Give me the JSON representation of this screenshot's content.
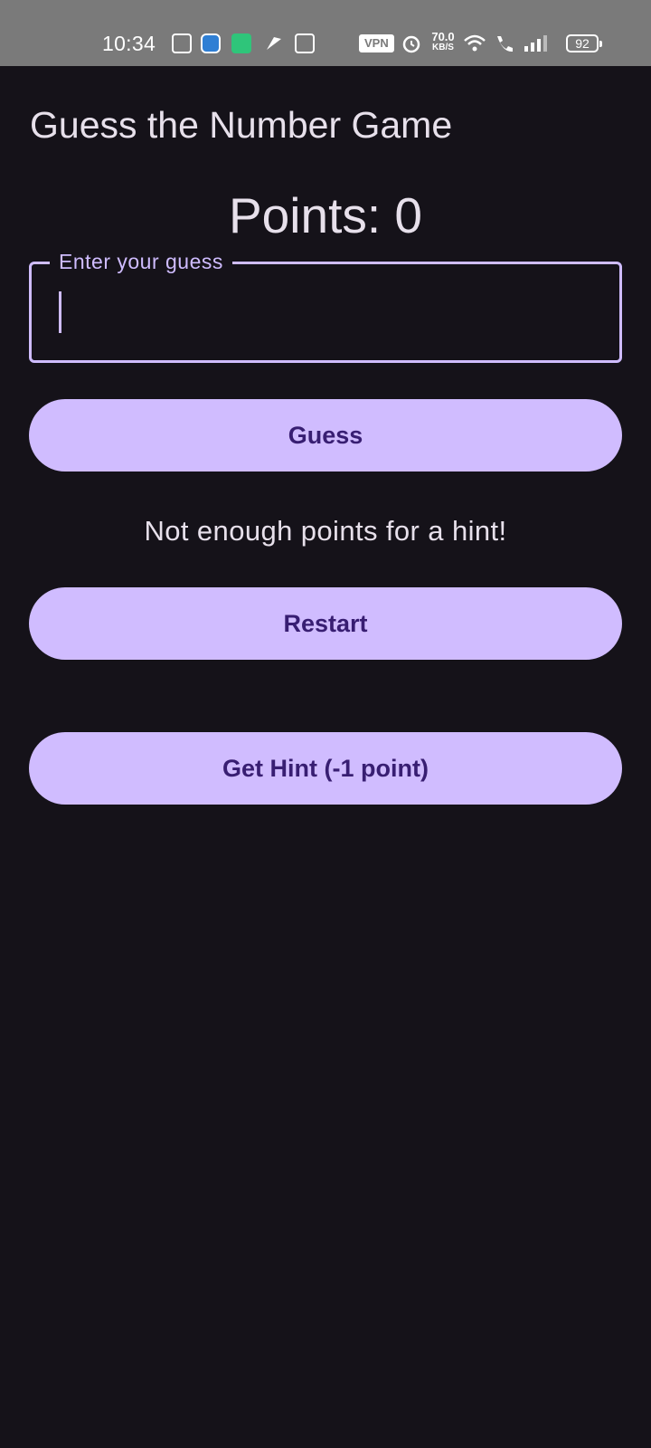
{
  "status_bar": {
    "time": "10:34",
    "vpn": "VPN",
    "speed_value": "70.0",
    "speed_unit": "KB/S",
    "battery": "92",
    "icons": [
      "grid-icon",
      "shield-icon",
      "battery-saver-icon",
      "pinwheel-icon",
      "contacts-icon",
      "alarm-icon",
      "wifi-icon",
      "wifi-call-icon",
      "signal-icon"
    ]
  },
  "app": {
    "title": "Guess the Number Game"
  },
  "game": {
    "points_text": "Points: 0",
    "guess_field": {
      "label": "Enter your guess",
      "value": ""
    },
    "guess_button": "Guess",
    "message": "Not enough points for a hint!",
    "restart_button": "Restart",
    "hint_button": "Get Hint (-1 point)"
  },
  "colors": {
    "background": "#151219",
    "accent": "#d0bcff",
    "button_text": "#381e72",
    "text": "#e7e0eb",
    "status_bar": "#7a7a7a"
  }
}
